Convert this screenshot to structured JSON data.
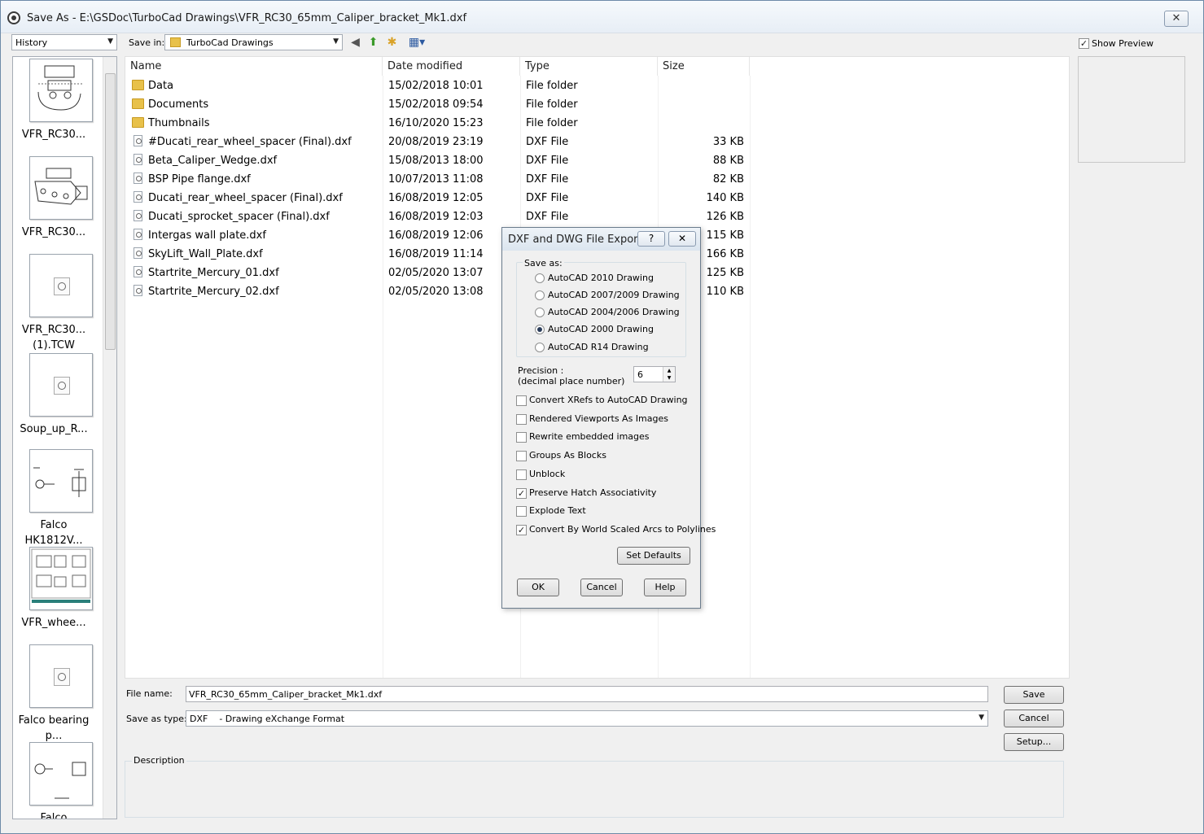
{
  "window": {
    "title": "Save As - E:\\GSDoc\\TurboCad Drawings\\VFR_RC30_65mm_Caliper_bracket_Mk1.dxf",
    "close_glyph": "✕"
  },
  "toolbar": {
    "history_combo": "History",
    "save_in_label": "Save in:",
    "save_in_value": "TurboCad Drawings",
    "back_glyph": "◀",
    "up_glyph": "⬆",
    "new_folder_glyph": "✱",
    "view_glyph": "▦▾",
    "show_preview_label": "Show Preview",
    "show_preview_checked": true
  },
  "history": {
    "items": [
      {
        "label": "VFR_RC30..."
      },
      {
        "label": "VFR_RC30..."
      },
      {
        "label": "VFR_RC30... (1).TCW"
      },
      {
        "label": "Soup_up_R..."
      },
      {
        "label": "Falco HK1812V..."
      },
      {
        "label": "VFR_whee..."
      },
      {
        "label": "Falco bearing p..."
      },
      {
        "label": "Falco"
      }
    ]
  },
  "columns": {
    "name": "Name",
    "date": "Date modified",
    "type": "Type",
    "size": "Size"
  },
  "files": [
    {
      "name": "Data",
      "date": "15/02/2018 10:01",
      "type": "File folder",
      "size": "",
      "kind": "folder"
    },
    {
      "name": "Documents",
      "date": "15/02/2018 09:54",
      "type": "File folder",
      "size": "",
      "kind": "folder"
    },
    {
      "name": "Thumbnails",
      "date": "16/10/2020 15:23",
      "type": "File folder",
      "size": "",
      "kind": "folder"
    },
    {
      "name": "#Ducati_rear_wheel_spacer (Final).dxf",
      "date": "20/08/2019 23:19",
      "type": "DXF File",
      "size": "33 KB",
      "kind": "dxf"
    },
    {
      "name": "Beta_Caliper_Wedge.dxf",
      "date": "15/08/2013 18:00",
      "type": "DXF File",
      "size": "88 KB",
      "kind": "dxf"
    },
    {
      "name": "BSP Pipe flange.dxf",
      "date": "10/07/2013 11:08",
      "type": "DXF File",
      "size": "82 KB",
      "kind": "dxf"
    },
    {
      "name": "Ducati_rear_wheel_spacer (Final).dxf",
      "date": "16/08/2019 12:05",
      "type": "DXF File",
      "size": "140 KB",
      "kind": "dxf"
    },
    {
      "name": "Ducati_sprocket_spacer (Final).dxf",
      "date": "16/08/2019 12:03",
      "type": "DXF File",
      "size": "126 KB",
      "kind": "dxf"
    },
    {
      "name": "Intergas wall plate.dxf",
      "date": "16/08/2019 12:06",
      "type": "",
      "size": "115 KB",
      "kind": "dxf"
    },
    {
      "name": "SkyLift_Wall_Plate.dxf",
      "date": "16/08/2019 11:14",
      "type": "",
      "size": "166 KB",
      "kind": "dxf"
    },
    {
      "name": "Startrite_Mercury_01.dxf",
      "date": "02/05/2020 13:07",
      "type": "",
      "size": "125 KB",
      "kind": "dxf"
    },
    {
      "name": "Startrite_Mercury_02.dxf",
      "date": "02/05/2020 13:08",
      "type": "",
      "size": "110 KB",
      "kind": "dxf"
    }
  ],
  "bottom": {
    "file_name_label": "File name:",
    "file_name_value": "VFR_RC30_65mm_Caliper_bracket_Mk1.dxf",
    "save_as_type_label": "Save as type:",
    "save_as_type_value": "DXF    - Drawing eXchange Format",
    "save_button": "Save",
    "cancel_button": "Cancel",
    "setup_button": "Setup...",
    "description_label": "Description"
  },
  "dialog": {
    "title": "DXF and DWG File Export",
    "help_glyph": "?",
    "close_glyph": "✕",
    "save_as_label": "Save as:",
    "options": [
      {
        "label": "AutoCAD 2010 Drawing",
        "selected": false
      },
      {
        "label": "AutoCAD 2007/2009 Drawing",
        "selected": false
      },
      {
        "label": "AutoCAD 2004/2006 Drawing",
        "selected": false
      },
      {
        "label": "AutoCAD 2000 Drawing",
        "selected": true
      },
      {
        "label": "AutoCAD R14 Drawing",
        "selected": false
      }
    ],
    "precision_label": "Precision :",
    "precision_sub": "(decimal place number)",
    "precision_value": "6",
    "checks": [
      {
        "label": "Convert XRefs to AutoCAD Drawing",
        "checked": false
      },
      {
        "label": "Rendered Viewports As Images",
        "checked": false
      },
      {
        "label": "Rewrite embedded images",
        "checked": false
      },
      {
        "label": "Groups As Blocks",
        "checked": false
      },
      {
        "label": "Unblock",
        "checked": false
      },
      {
        "label": "Preserve Hatch Associativity",
        "checked": true
      },
      {
        "label": "Explode Text",
        "checked": false
      },
      {
        "label": "Convert By World Scaled Arcs to Polylines",
        "checked": true
      }
    ],
    "set_defaults": "Set Defaults",
    "ok": "OK",
    "cancel": "Cancel",
    "help": "Help"
  }
}
